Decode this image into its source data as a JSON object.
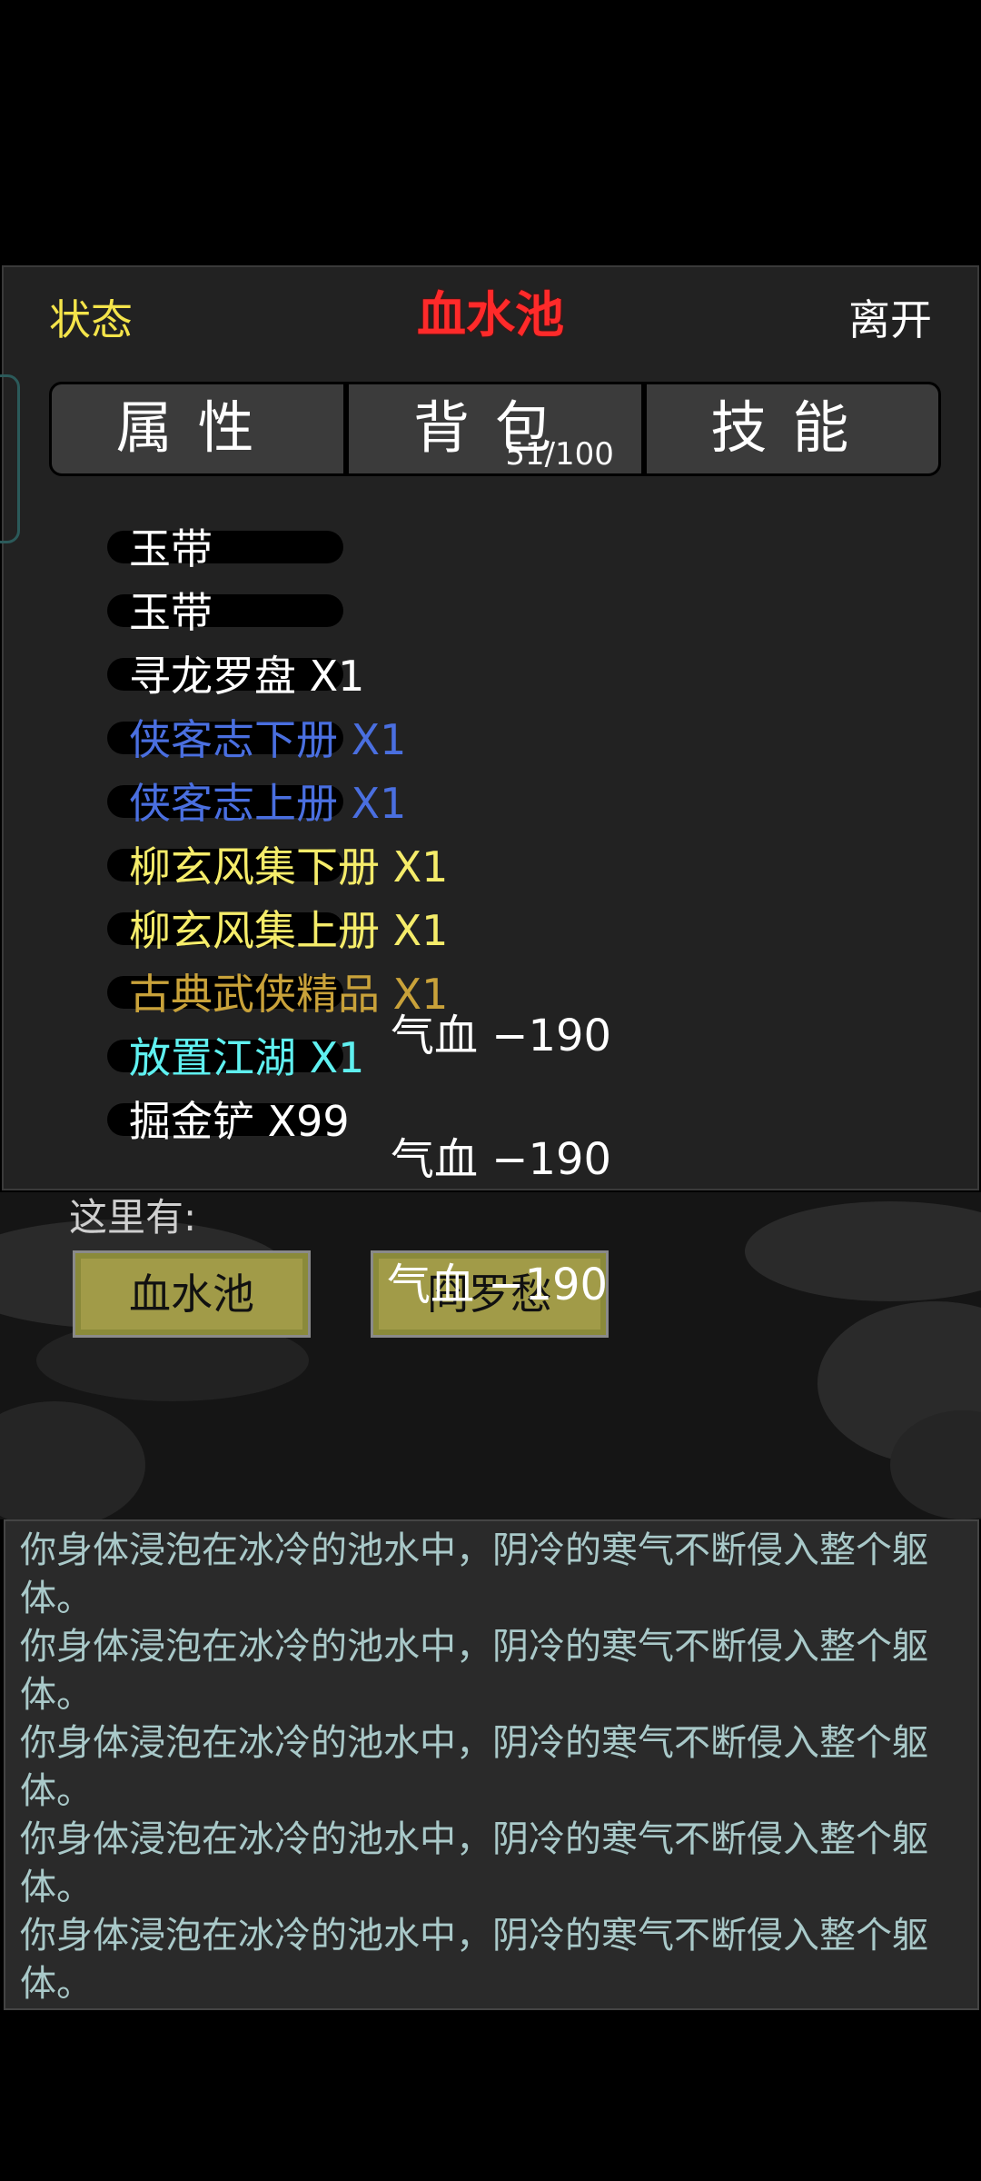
{
  "header": {
    "status_label": "状态",
    "title": "血水池",
    "leave_label": "离开"
  },
  "tabs": [
    {
      "label": "属性"
    },
    {
      "label": "背包",
      "sub": "51/100"
    },
    {
      "label": "技能"
    }
  ],
  "inventory": [
    {
      "name": "玉带",
      "color": "#ffffff"
    },
    {
      "name": "玉带",
      "color": "#ffffff"
    },
    {
      "name": "寻龙罗盘 X1",
      "color": "#ffffff"
    },
    {
      "name": "侠客志下册 X1",
      "color": "#4a6fe0"
    },
    {
      "name": "侠客志上册 X1",
      "color": "#4a6fe0"
    },
    {
      "name": "柳玄风集下册 X1",
      "color": "#f5ec6a"
    },
    {
      "name": "柳玄风集上册 X1",
      "color": "#f5ec6a"
    },
    {
      "name": "古典武侠精品 X1",
      "color": "#c9a23a"
    },
    {
      "name": "放置江湖 X1",
      "color": "#5ff0f0"
    },
    {
      "name": "掘金铲 X99",
      "color": "#ffffff"
    }
  ],
  "damage_popups": [
    "气血 −190",
    "气血 −190",
    "气血 −190"
  ],
  "scene": {
    "here_label": "这里有:",
    "locations": [
      "血水池",
      "冏罗愁"
    ]
  },
  "log": [
    "你身体浸泡在冰冷的池水中，阴冷的寒气不断侵入整个躯体。",
    "你身体浸泡在冰冷的池水中，阴冷的寒气不断侵入整个躯体。",
    "你身体浸泡在冰冷的池水中，阴冷的寒气不断侵入整个躯体。",
    "你身体浸泡在冰冷的池水中，阴冷的寒气不断侵入整个躯体。",
    "你身体浸泡在冰冷的池水中，阴冷的寒气不断侵入整个躯体。"
  ]
}
